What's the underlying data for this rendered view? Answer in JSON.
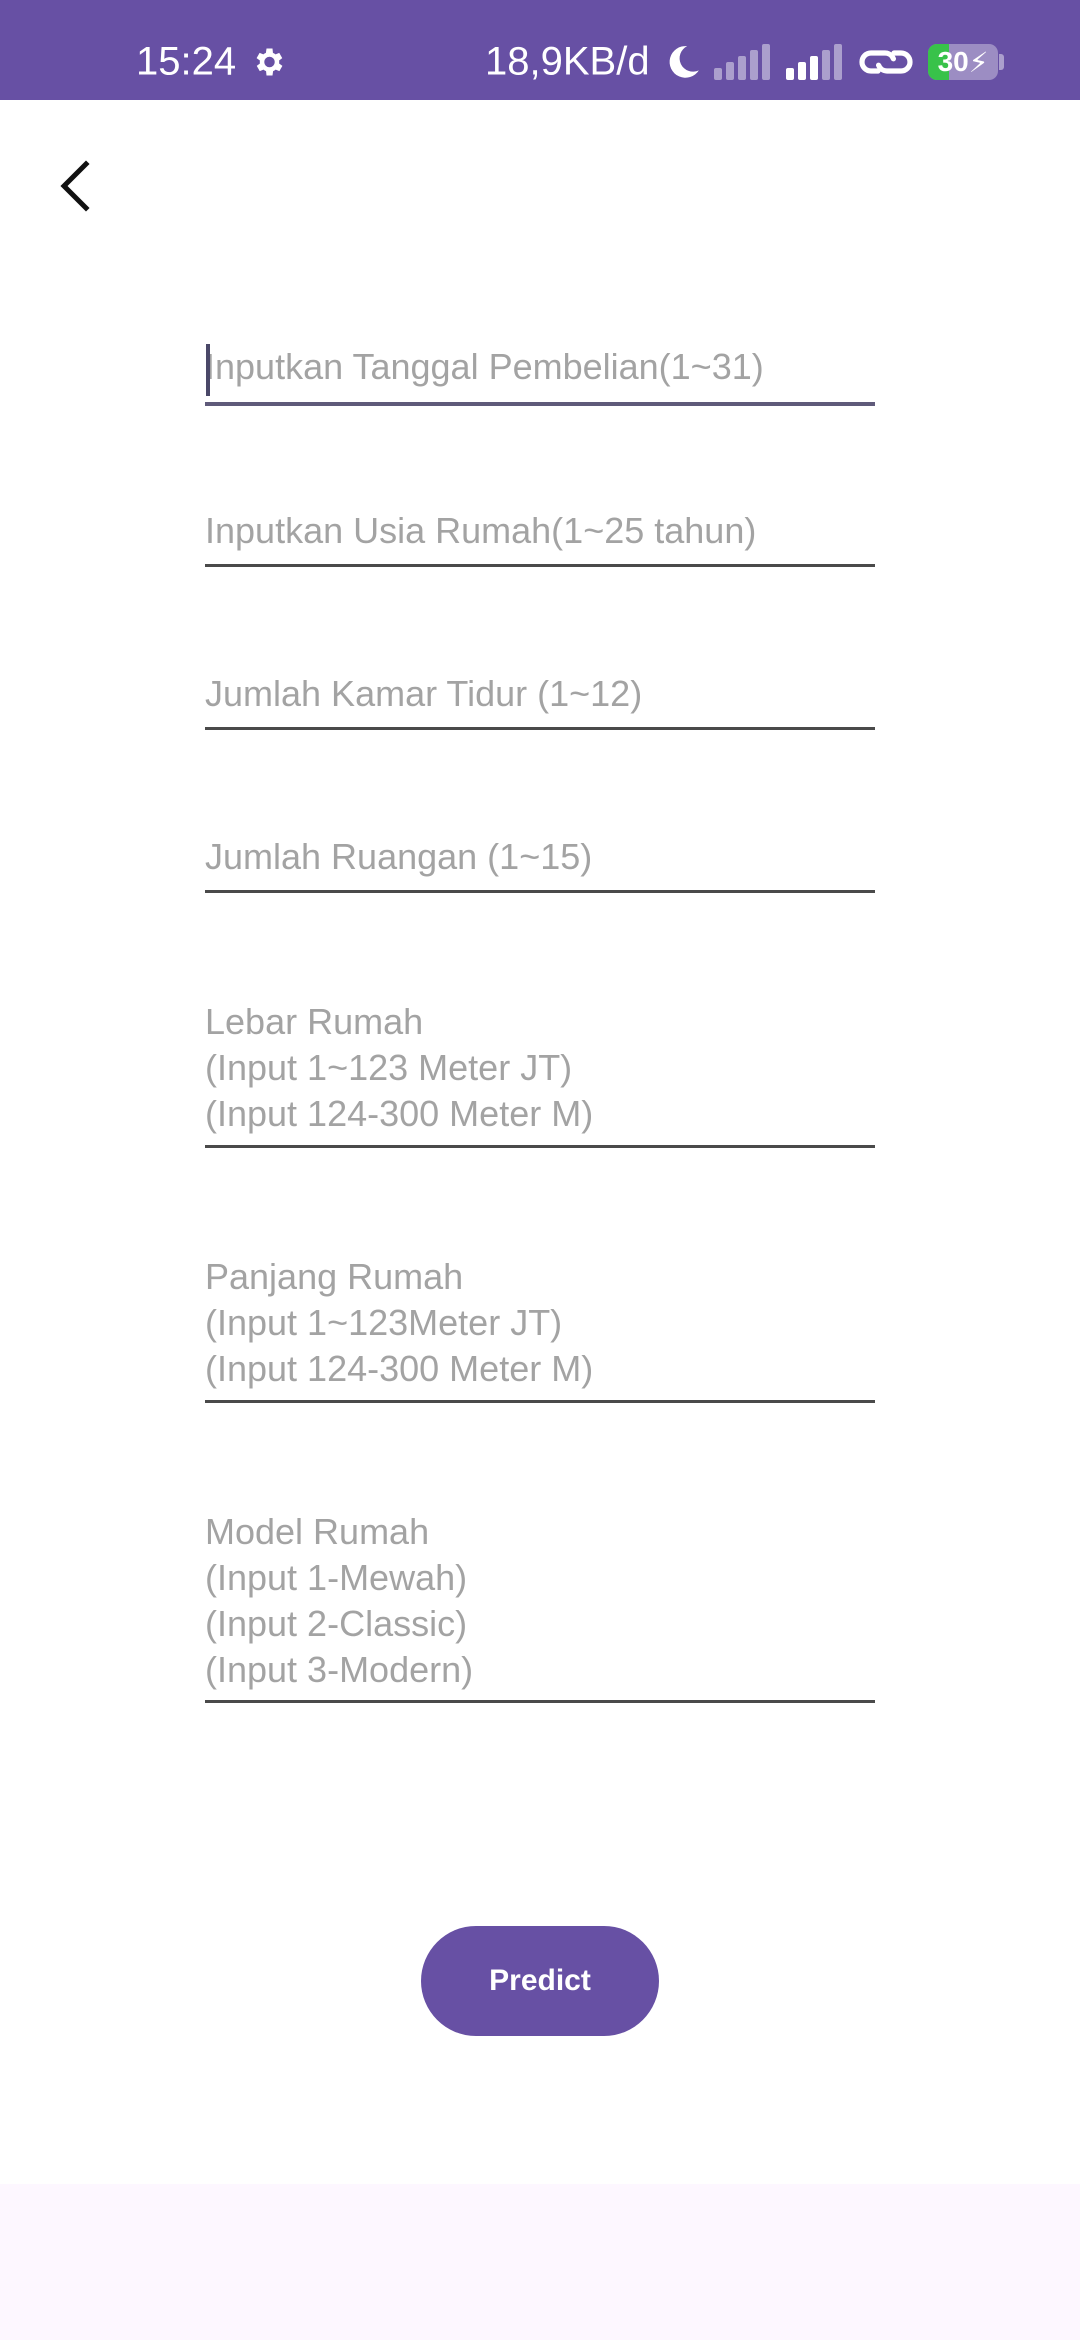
{
  "status_bar": {
    "time": "15:24",
    "net_speed": "18,9KB/d",
    "battery_level": "30",
    "battery_fraction": 0.3,
    "background_color": "#6750A4",
    "icons": [
      "gear-icon",
      "moon-icon",
      "signal-icon",
      "signal-icon",
      "link-icon",
      "battery-charging-icon"
    ]
  },
  "toolbar": {
    "back_icon": "chevron-left-icon"
  },
  "form": {
    "fields": [
      {
        "placeholder": "Inputkan Tanggal Pembelian(1~31)",
        "value": ""
      },
      {
        "placeholder": "Inputkan Usia Rumah(1~25 tahun)",
        "value": ""
      },
      {
        "placeholder": "Jumlah Kamar Tidur (1~12)",
        "value": ""
      },
      {
        "placeholder": "Jumlah Ruangan (1~15)",
        "value": ""
      },
      {
        "placeholder": "Lebar Rumah\n(Input 1~123 Meter JT)\n(Input 124-300 Meter M)",
        "value": ""
      },
      {
        "placeholder": "Panjang Rumah\n(Input 1~123Meter JT)\n(Input 124-300 Meter M)",
        "value": ""
      },
      {
        "placeholder": "Model Rumah\n(Input 1-Mewah)\n(Input 2-Classic)\n(Input 3-Modern)",
        "value": ""
      }
    ],
    "predict_label": "Predict",
    "accent_color": "#6750A4"
  }
}
